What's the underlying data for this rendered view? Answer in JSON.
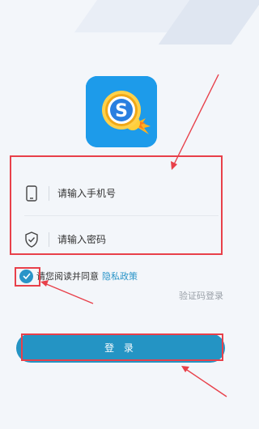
{
  "form": {
    "phone_placeholder": "请输入手机号",
    "password_placeholder": "请输入密码"
  },
  "agreement": {
    "text": "请您阅读并同意",
    "link": "隐私政策",
    "checked": true
  },
  "alt_login": "验证码登录",
  "login_button": "登 录",
  "icons": {
    "logo": "app-logo-s-magnifier",
    "phone": "mobile-phone-icon",
    "password": "shield-check-icon",
    "checkbox": "check-icon"
  },
  "colors": {
    "accent": "#2494c4",
    "highlight_box": "#e8404a",
    "background": "#f3f6fa"
  }
}
